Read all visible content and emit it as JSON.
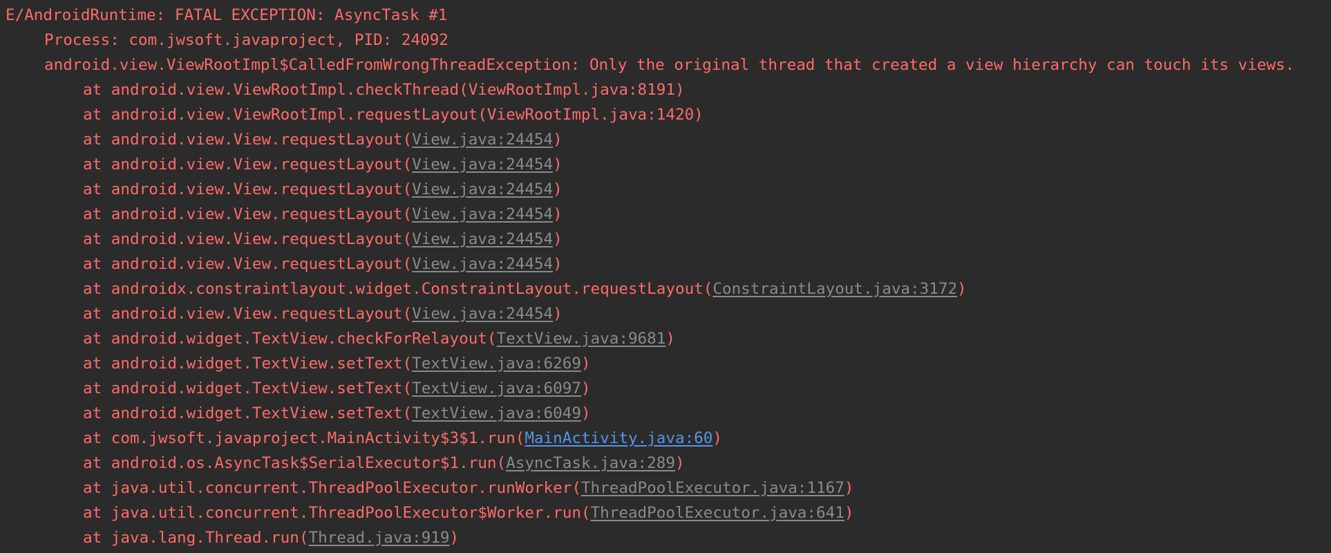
{
  "logcat": {
    "header": "E/AndroidRuntime: FATAL EXCEPTION: AsyncTask #1",
    "process": "Process: com.jwsoft.javaproject, PID: 24092",
    "exception": "android.view.ViewRootImpl$CalledFromWrongThreadException: Only the original thread that created a view hierarchy can touch its views.",
    "frames": [
      {
        "method": "at android.view.ViewRootImpl.checkThread(ViewRootImpl.java:8191)",
        "link": "",
        "close": ""
      },
      {
        "method": "at android.view.ViewRootImpl.requestLayout(ViewRootImpl.java:1420)",
        "link": "",
        "close": ""
      },
      {
        "method": "at android.view.View.requestLayout(",
        "link": "View.java:24454",
        "close": ")"
      },
      {
        "method": "at android.view.View.requestLayout(",
        "link": "View.java:24454",
        "close": ")"
      },
      {
        "method": "at android.view.View.requestLayout(",
        "link": "View.java:24454",
        "close": ")"
      },
      {
        "method": "at android.view.View.requestLayout(",
        "link": "View.java:24454",
        "close": ")"
      },
      {
        "method": "at android.view.View.requestLayout(",
        "link": "View.java:24454",
        "close": ")"
      },
      {
        "method": "at android.view.View.requestLayout(",
        "link": "View.java:24454",
        "close": ")"
      },
      {
        "method": "at androidx.constraintlayout.widget.ConstraintLayout.requestLayout(",
        "link": "ConstraintLayout.java:3172",
        "close": ")"
      },
      {
        "method": "at android.view.View.requestLayout(",
        "link": "View.java:24454",
        "close": ")"
      },
      {
        "method": "at android.widget.TextView.checkForRelayout(",
        "link": "TextView.java:9681",
        "close": ")"
      },
      {
        "method": "at android.widget.TextView.setText(",
        "link": "TextView.java:6269",
        "close": ")"
      },
      {
        "method": "at android.widget.TextView.setText(",
        "link": "TextView.java:6097",
        "close": ")"
      },
      {
        "method": "at android.widget.TextView.setText(",
        "link": "TextView.java:6049",
        "close": ")"
      },
      {
        "method": "at com.jwsoft.javaproject.MainActivity$3$1.run(",
        "link": "MainActivity.java:60",
        "close": ")"
      },
      {
        "method": "at android.os.AsyncTask$SerialExecutor$1.run(",
        "link": "AsyncTask.java:289",
        "close": ")"
      },
      {
        "method": "at java.util.concurrent.ThreadPoolExecutor.runWorker(",
        "link": "ThreadPoolExecutor.java:1167",
        "close": ")"
      },
      {
        "method": "at java.util.concurrent.ThreadPoolExecutor$Worker.run(",
        "link": "ThreadPoolExecutor.java:641",
        "close": ")"
      },
      {
        "method": "at java.lang.Thread.run(",
        "link": "Thread.java:919",
        "close": ")"
      }
    ]
  },
  "colors": {
    "background": "#2b2b2b",
    "error_text": "#ff6b68",
    "library_link": "#8a8a8a",
    "project_link": "#5394ec"
  }
}
